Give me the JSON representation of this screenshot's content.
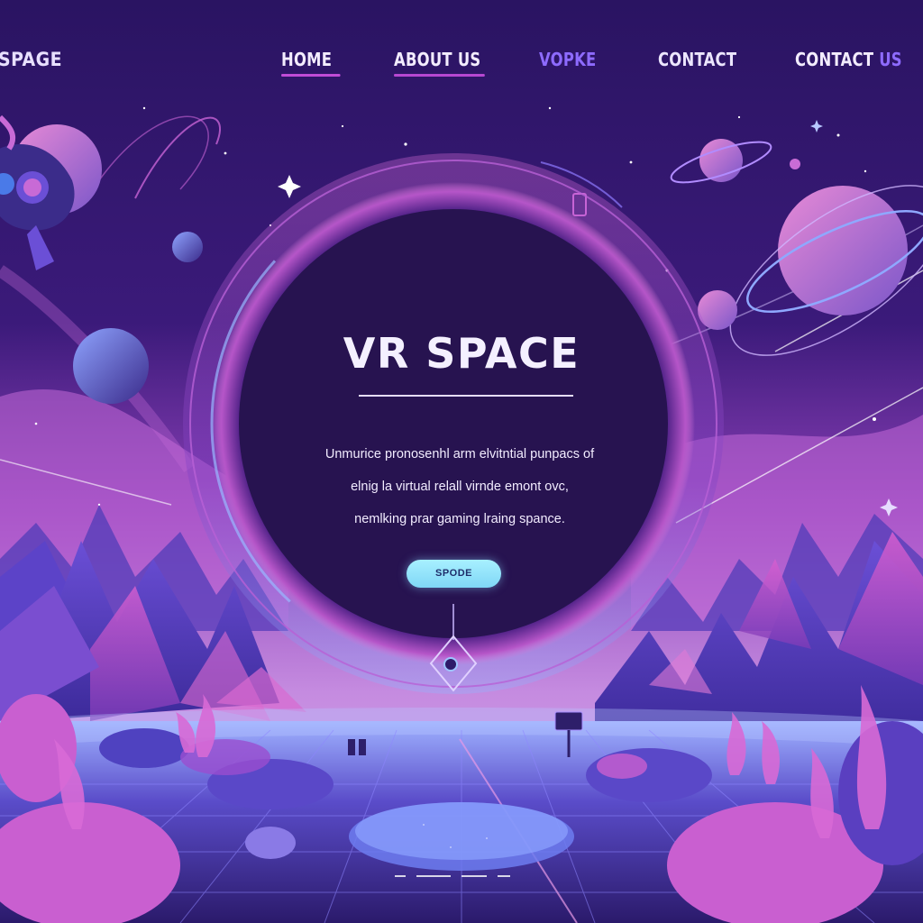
{
  "header": {
    "logo": "SPAGE",
    "nav": [
      {
        "label": "HOME",
        "active": true
      },
      {
        "label": "ABOUT US",
        "active": true
      },
      {
        "label": "VOPKE",
        "active": false
      },
      {
        "label": "CONTACT",
        "active": false
      },
      {
        "label": "CONTACT",
        "accent": "US"
      }
    ]
  },
  "hero": {
    "title": "VR SPACE",
    "description_lines": [
      "Unmurice pronosenhl arm elvitntial punpacs of",
      "elnig la virtual relall virnde emont ovc,",
      "nemlking prar gaming lraing spance."
    ],
    "cta_label": "SPODE"
  },
  "colors": {
    "background": "#2a1560",
    "accent_pink": "#c04cd6",
    "accent_violet": "#8e6bff",
    "cta": "#8fe3fa"
  }
}
